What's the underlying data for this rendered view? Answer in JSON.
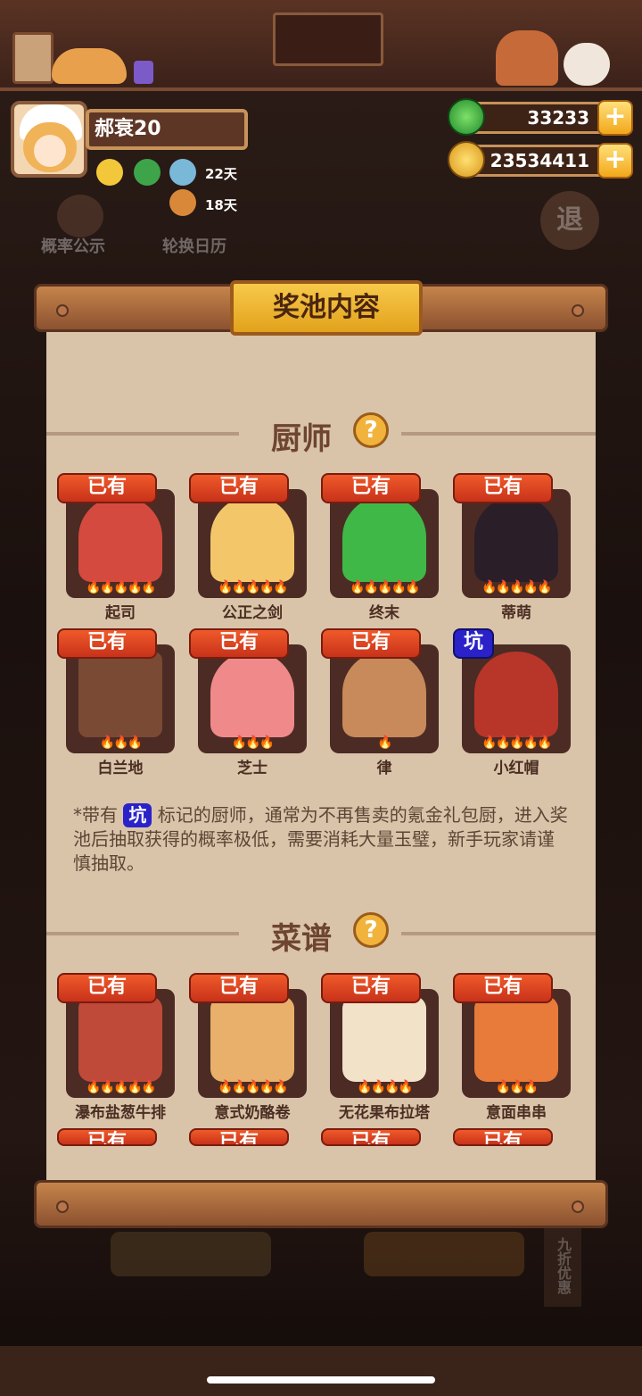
{
  "player": {
    "name": "郝衰20"
  },
  "buffs": {
    "days1": "22天",
    "days2": "18天"
  },
  "currency": {
    "jade": "33233",
    "coins": "23534411",
    "plus": "+"
  },
  "background": {
    "probability": "概率公示",
    "calendar": "轮换日历",
    "ten_discount": "九折优惠",
    "retreat": "退"
  },
  "panel": {
    "title": "奖池内容"
  },
  "chefs": {
    "title": "厨师",
    "help": "?",
    "items": [
      {
        "name": "起司",
        "tag": "已有"
      },
      {
        "name": "公正之剑",
        "tag": "已有"
      },
      {
        "name": "终末",
        "tag": "已有"
      },
      {
        "name": "蒂萌",
        "tag": "已有"
      },
      {
        "name": "白兰地",
        "tag": "已有"
      },
      {
        "name": "芝士",
        "tag": "已有"
      },
      {
        "name": "律",
        "tag": "已有"
      },
      {
        "name": "小红帽",
        "tag": "坑"
      }
    ]
  },
  "note": {
    "prefix": "*带有",
    "tag": "坑",
    "text": "标记的厨师，通常为不再售卖的氪金礼包厨，进入奖池后抽取获得的概率极低，需要消耗大量玉璧，新手玩家请谨慎抽取。"
  },
  "recipes": {
    "title": "菜谱",
    "help": "?",
    "items": [
      {
        "name": "瀑布盐葱牛排",
        "tag": "已有"
      },
      {
        "name": "意式奶酪卷",
        "tag": "已有"
      },
      {
        "name": "无花果布拉塔",
        "tag": "已有"
      },
      {
        "name": "意面串串",
        "tag": "已有"
      }
    ],
    "partial_tag": "已有"
  },
  "colors": {
    "tag_red": "#e0431f",
    "tag_blue": "#2a22c8",
    "paper": "#d9c4aa",
    "card": "#4b2b24",
    "gold": "#f2b33d"
  }
}
